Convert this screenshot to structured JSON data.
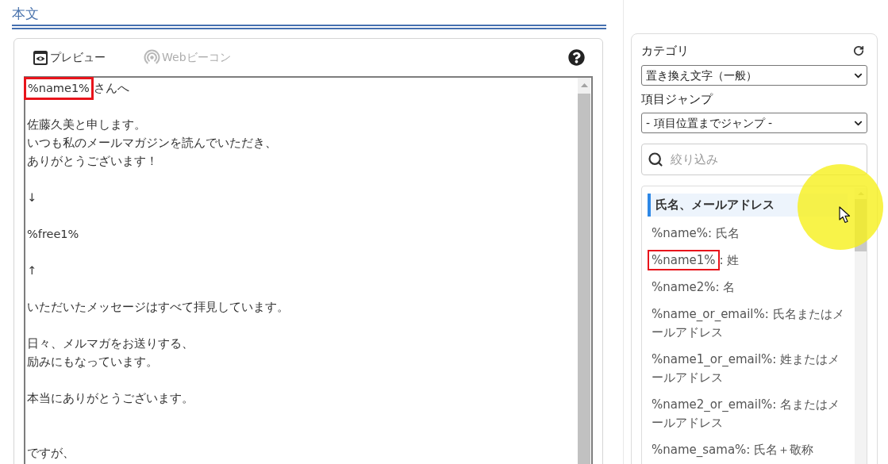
{
  "section": {
    "title": "本文"
  },
  "editor": {
    "tabs": [
      {
        "kind": "preview",
        "label": "プレビュー",
        "disabled": false
      },
      {
        "kind": "beacon",
        "label": "Webビーコン",
        "disabled": true
      }
    ],
    "lines": [
      {
        "kind": "text",
        "parts": [
          {
            "text": "%name1%",
            "boxed": true
          },
          {
            "text": "さんへ",
            "boxed": false
          }
        ]
      },
      {
        "kind": "blank"
      },
      {
        "kind": "text",
        "parts": [
          {
            "text": "佐藤久美と申します。",
            "boxed": false
          }
        ]
      },
      {
        "kind": "text",
        "parts": [
          {
            "text": "いつも私のメールマガジンを読んでいただき、",
            "boxed": false
          }
        ]
      },
      {
        "kind": "text",
        "parts": [
          {
            "text": "ありがとうございます！",
            "boxed": false
          }
        ]
      },
      {
        "kind": "blank"
      },
      {
        "kind": "text",
        "parts": [
          {
            "text": "↓",
            "boxed": false
          }
        ]
      },
      {
        "kind": "blank"
      },
      {
        "kind": "text",
        "parts": [
          {
            "text": "%free1%",
            "boxed": false
          }
        ]
      },
      {
        "kind": "blank"
      },
      {
        "kind": "text",
        "parts": [
          {
            "text": "↑",
            "boxed": false
          }
        ]
      },
      {
        "kind": "blank"
      },
      {
        "kind": "text",
        "parts": [
          {
            "text": "いただいたメッセージはすべて拝見しています。",
            "boxed": false
          }
        ]
      },
      {
        "kind": "blank"
      },
      {
        "kind": "text",
        "parts": [
          {
            "text": "日々、メルマガをお送りする、",
            "boxed": false
          }
        ]
      },
      {
        "kind": "text",
        "parts": [
          {
            "text": "励みにもなっています。",
            "boxed": false
          }
        ]
      },
      {
        "kind": "blank"
      },
      {
        "kind": "text",
        "parts": [
          {
            "text": "本当にありがとうございます。",
            "boxed": false
          }
        ]
      },
      {
        "kind": "blank"
      },
      {
        "kind": "blank"
      },
      {
        "kind": "text",
        "parts": [
          {
            "text": "ですが、",
            "boxed": false
          }
        ]
      }
    ]
  },
  "sidebar": {
    "category": {
      "label": "カテゴリ",
      "value": "置き換え文字（一般）"
    },
    "jump": {
      "label": "項目ジャンプ",
      "value": "- 項目位置までジャンプ -"
    },
    "filter": {
      "placeholder": "絞り込み"
    },
    "list": {
      "heading": "氏名、メールアドレス",
      "items": [
        {
          "parts": [
            {
              "text": "%name%: 氏名",
              "boxed": false
            }
          ]
        },
        {
          "parts": [
            {
              "text": "%name1%",
              "boxed": true
            },
            {
              "text": ": 姓",
              "boxed": false
            }
          ]
        },
        {
          "parts": [
            {
              "text": "%name2%: 名",
              "boxed": false
            }
          ]
        },
        {
          "parts": [
            {
              "text": "%name_or_email%: 氏名またはメールアドレス",
              "boxed": false
            }
          ]
        },
        {
          "parts": [
            {
              "text": "%name1_or_email%: 姓またはメールアドレス",
              "boxed": false
            }
          ]
        },
        {
          "parts": [
            {
              "text": "%name2_or_email%: 名またはメールアドレス",
              "boxed": false
            }
          ]
        },
        {
          "parts": [
            {
              "text": "%name_sama%: 氏名＋敬称",
              "boxed": false
            }
          ]
        }
      ]
    }
  }
}
